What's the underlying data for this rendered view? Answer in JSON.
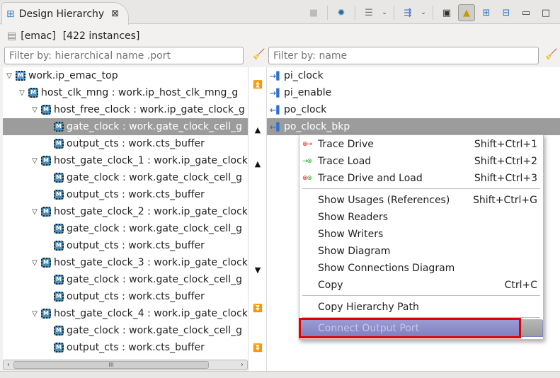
{
  "tab": {
    "title": "Design Hierarchy",
    "close": "⊠"
  },
  "toolbar": {
    "icons": [
      "stop-icon",
      "trace-icon",
      "list-icon",
      "columns-icon",
      "diagram-icon",
      "link-with-editor-icon",
      "expand-all-icon",
      "collapse-all-icon",
      "minimize-icon",
      "maximize-icon"
    ]
  },
  "info": {
    "design": "[emac]",
    "count": "[422 instances]"
  },
  "filters": {
    "hier_placeholder": "Filter by: hierarchical name .port",
    "name_placeholder": "Filter by: name"
  },
  "tree": [
    {
      "label": "work.ip_emac_top",
      "depth": 0,
      "expanded": true,
      "kind": "module"
    },
    {
      "label": "host_clk_mng : work.ip_host_clk_mng_g",
      "depth": 1,
      "expanded": true
    },
    {
      "label": "host_free_clock : work.ip_gate_clock_g",
      "depth": 2,
      "expanded": true
    },
    {
      "label": "gate_clock : work.gate_clock_cell_g",
      "depth": 3,
      "selected": true
    },
    {
      "label": "output_cts : work.cts_buffer",
      "depth": 3
    },
    {
      "label": "host_gate_clock_1 : work.ip_gate_clock",
      "depth": 2,
      "expanded": true
    },
    {
      "label": "gate_clock : work.gate_clock_cell_g",
      "depth": 3
    },
    {
      "label": "output_cts : work.cts_buffer",
      "depth": 3
    },
    {
      "label": "host_gate_clock_2 : work.ip_gate_clock",
      "depth": 2,
      "expanded": true
    },
    {
      "label": "gate_clock : work.gate_clock_cell_g",
      "depth": 3
    },
    {
      "label": "output_cts : work.cts_buffer",
      "depth": 3
    },
    {
      "label": "host_gate_clock_3 : work.ip_gate_clock",
      "depth": 2,
      "expanded": true
    },
    {
      "label": "gate_clock : work.gate_clock_cell_g",
      "depth": 3
    },
    {
      "label": "output_cts : work.cts_buffer",
      "depth": 3
    },
    {
      "label": "host_gate_clock_4 : work.ip_gate_clock",
      "depth": 2,
      "expanded": true
    },
    {
      "label": "gate_clock : work.gate_clock_cell_g",
      "depth": 3
    },
    {
      "label": "output_cts : work.cts_buffer",
      "depth": 3
    }
  ],
  "ports": [
    {
      "label": "pi_clock",
      "dir": "in"
    },
    {
      "label": "pi_enable",
      "dir": "in"
    },
    {
      "label": "po_clock",
      "dir": "out"
    },
    {
      "label": "po_clock_bkp",
      "dir": "out",
      "selected": true
    }
  ],
  "menu": {
    "trace_drive": {
      "label": "Trace Drive",
      "shortcut": "Shift+Ctrl+1"
    },
    "trace_load": {
      "label": "Trace Load",
      "shortcut": "Shift+Ctrl+2"
    },
    "trace_both": {
      "label": "Trace Drive and Load",
      "shortcut": "Shift+Ctrl+3"
    },
    "usages": {
      "label": "Show Usages (References)",
      "shortcut": "Shift+Ctrl+G"
    },
    "readers": {
      "label": "Show Readers"
    },
    "writers": {
      "label": "Show Writers"
    },
    "diagram": {
      "label": "Show Diagram"
    },
    "conn_diagram": {
      "label": "Show Connections Diagram"
    },
    "copy": {
      "label": "Copy",
      "shortcut": "Ctrl+C"
    },
    "copy_path": {
      "label": "Copy Hierarchy Path"
    },
    "connect_output": {
      "label": "Connect Output Port"
    }
  },
  "scrollbar": {
    "grip": "III"
  }
}
